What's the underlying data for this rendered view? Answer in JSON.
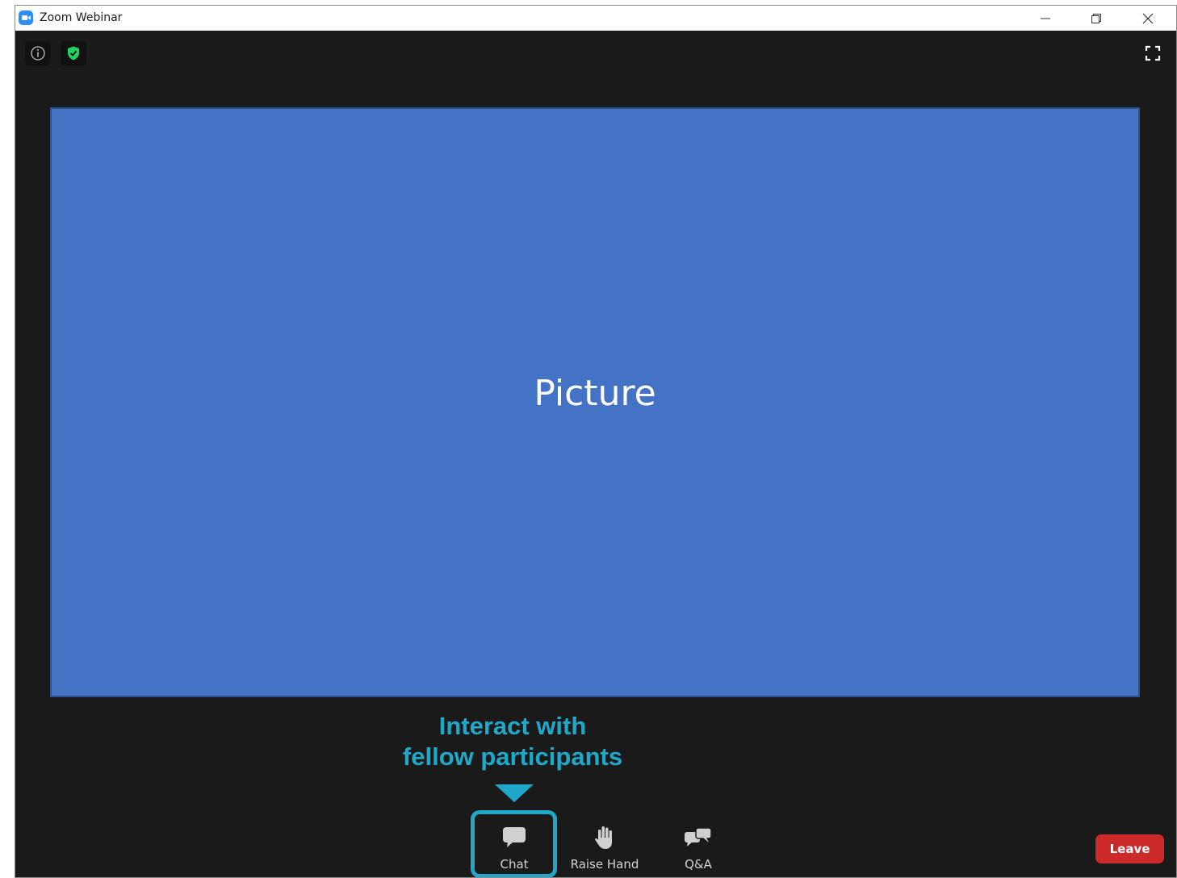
{
  "window": {
    "title": "Zoom Webinar",
    "icon": "zoom-logo-icon",
    "controls": [
      "minimize-icon",
      "restore-icon",
      "close-icon"
    ]
  },
  "top_bar": {
    "info_icon": "info-icon",
    "security_icon": "shield-check-icon",
    "fullscreen_icon": "fullscreen-icon"
  },
  "share": {
    "label": "Picture",
    "background": "#4472c4"
  },
  "callout": {
    "line1": "Interact with",
    "line2": "fellow participants",
    "color": "#1fa8c9"
  },
  "toolbar": {
    "items": [
      {
        "label": "Chat",
        "icon": "chat-bubble-icon",
        "highlighted": true
      },
      {
        "label": "Raise Hand",
        "icon": "hand-icon",
        "highlighted": false
      },
      {
        "label": "Q&A",
        "icon": "qa-bubbles-icon",
        "highlighted": false
      }
    ],
    "leave_label": "Leave",
    "leave_color": "#cc2a2a"
  }
}
